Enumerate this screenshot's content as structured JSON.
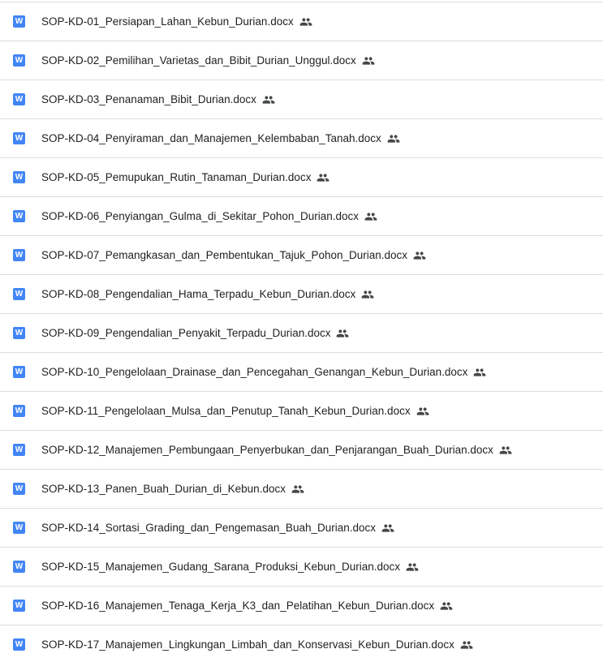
{
  "colors": {
    "doc_icon_bg": "#4285f4",
    "text": "#1f1f1f",
    "shared_icon": "#444746",
    "divider": "#dadce0"
  },
  "doc_icon_letter": "W",
  "files": [
    {
      "name": "SOP-KD-01_Persiapan_Lahan_Kebun_Durian.docx",
      "shared_icon": "shared-people-icon"
    },
    {
      "name": "SOP-KD-02_Pemilihan_Varietas_dan_Bibit_Durian_Unggul.docx",
      "shared_icon": "shared-people-icon"
    },
    {
      "name": "SOP-KD-03_Penanaman_Bibit_Durian.docx",
      "shared_icon": "shared-people-icon"
    },
    {
      "name": "SOP-KD-04_Penyiraman_dan_Manajemen_Kelembaban_Tanah.docx",
      "shared_icon": "shared-people-icon"
    },
    {
      "name": "SOP-KD-05_Pemupukan_Rutin_Tanaman_Durian.docx",
      "shared_icon": "shared-people-icon"
    },
    {
      "name": "SOP-KD-06_Penyiangan_Gulma_di_Sekitar_Pohon_Durian.docx",
      "shared_icon": "shared-people-icon"
    },
    {
      "name": "SOP-KD-07_Pemangkasan_dan_Pembentukan_Tajuk_Pohon_Durian.docx",
      "shared_icon": "shared-people-icon"
    },
    {
      "name": "SOP-KD-08_Pengendalian_Hama_Terpadu_Kebun_Durian.docx",
      "shared_icon": "shared-people-icon"
    },
    {
      "name": "SOP-KD-09_Pengendalian_Penyakit_Terpadu_Durian.docx",
      "shared_icon": "shared-people-icon"
    },
    {
      "name": "SOP-KD-10_Pengelolaan_Drainase_dan_Pencegahan_Genangan_Kebun_Durian.docx",
      "shared_icon": "shared-people-icon"
    },
    {
      "name": "SOP-KD-11_Pengelolaan_Mulsa_dan_Penutup_Tanah_Kebun_Durian.docx",
      "shared_icon": "shared-people-icon"
    },
    {
      "name": "SOP-KD-12_Manajemen_Pembungaan_Penyerbukan_dan_Penjarangan_Buah_Durian.docx",
      "shared_icon": "shared-people-icon"
    },
    {
      "name": "SOP-KD-13_Panen_Buah_Durian_di_Kebun.docx",
      "shared_icon": "shared-people-icon"
    },
    {
      "name": "SOP-KD-14_Sortasi_Grading_dan_Pengemasan_Buah_Durian.docx",
      "shared_icon": "shared-people-icon"
    },
    {
      "name": "SOP-KD-15_Manajemen_Gudang_Sarana_Produksi_Kebun_Durian.docx",
      "shared_icon": "shared-people-icon"
    },
    {
      "name": "SOP-KD-16_Manajemen_Tenaga_Kerja_K3_dan_Pelatihan_Kebun_Durian.docx",
      "shared_icon": "shared-people-icon"
    },
    {
      "name": "SOP-KD-17_Manajemen_Lingkungan_Limbah_dan_Konservasi_Kebun_Durian.docx",
      "shared_icon": "shared-people-icon"
    }
  ]
}
